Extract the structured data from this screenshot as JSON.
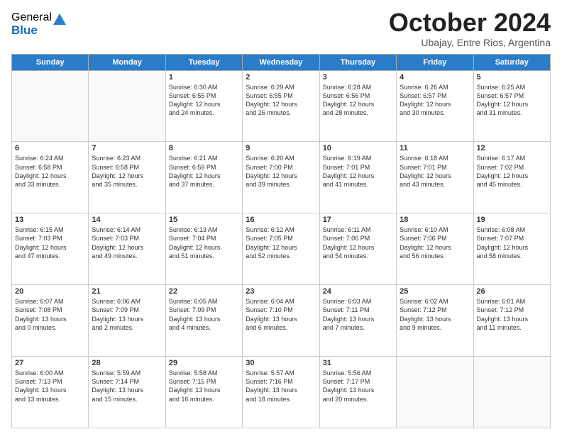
{
  "logo": {
    "general": "General",
    "blue": "Blue"
  },
  "header": {
    "month": "October 2024",
    "location": "Ubajay, Entre Rios, Argentina"
  },
  "days": [
    "Sunday",
    "Monday",
    "Tuesday",
    "Wednesday",
    "Thursday",
    "Friday",
    "Saturday"
  ],
  "weeks": [
    [
      {
        "day": "",
        "content": ""
      },
      {
        "day": "",
        "content": ""
      },
      {
        "day": "1",
        "content": "Sunrise: 6:30 AM\nSunset: 6:55 PM\nDaylight: 12 hours\nand 24 minutes."
      },
      {
        "day": "2",
        "content": "Sunrise: 6:29 AM\nSunset: 6:55 PM\nDaylight: 12 hours\nand 26 minutes."
      },
      {
        "day": "3",
        "content": "Sunrise: 6:28 AM\nSunset: 6:56 PM\nDaylight: 12 hours\nand 28 minutes."
      },
      {
        "day": "4",
        "content": "Sunrise: 6:26 AM\nSunset: 6:57 PM\nDaylight: 12 hours\nand 30 minutes."
      },
      {
        "day": "5",
        "content": "Sunrise: 6:25 AM\nSunset: 6:57 PM\nDaylight: 12 hours\nand 31 minutes."
      }
    ],
    [
      {
        "day": "6",
        "content": "Sunrise: 6:24 AM\nSunset: 6:58 PM\nDaylight: 12 hours\nand 33 minutes."
      },
      {
        "day": "7",
        "content": "Sunrise: 6:23 AM\nSunset: 6:58 PM\nDaylight: 12 hours\nand 35 minutes."
      },
      {
        "day": "8",
        "content": "Sunrise: 6:21 AM\nSunset: 6:59 PM\nDaylight: 12 hours\nand 37 minutes."
      },
      {
        "day": "9",
        "content": "Sunrise: 6:20 AM\nSunset: 7:00 PM\nDaylight: 12 hours\nand 39 minutes."
      },
      {
        "day": "10",
        "content": "Sunrise: 6:19 AM\nSunset: 7:01 PM\nDaylight: 12 hours\nand 41 minutes."
      },
      {
        "day": "11",
        "content": "Sunrise: 6:18 AM\nSunset: 7:01 PM\nDaylight: 12 hours\nand 43 minutes."
      },
      {
        "day": "12",
        "content": "Sunrise: 6:17 AM\nSunset: 7:02 PM\nDaylight: 12 hours\nand 45 minutes."
      }
    ],
    [
      {
        "day": "13",
        "content": "Sunrise: 6:15 AM\nSunset: 7:03 PM\nDaylight: 12 hours\nand 47 minutes."
      },
      {
        "day": "14",
        "content": "Sunrise: 6:14 AM\nSunset: 7:03 PM\nDaylight: 12 hours\nand 49 minutes."
      },
      {
        "day": "15",
        "content": "Sunrise: 6:13 AM\nSunset: 7:04 PM\nDaylight: 12 hours\nand 51 minutes."
      },
      {
        "day": "16",
        "content": "Sunrise: 6:12 AM\nSunset: 7:05 PM\nDaylight: 12 hours\nand 52 minutes."
      },
      {
        "day": "17",
        "content": "Sunrise: 6:11 AM\nSunset: 7:06 PM\nDaylight: 12 hours\nand 54 minutes."
      },
      {
        "day": "18",
        "content": "Sunrise: 6:10 AM\nSunset: 7:06 PM\nDaylight: 12 hours\nand 56 minutes."
      },
      {
        "day": "19",
        "content": "Sunrise: 6:08 AM\nSunset: 7:07 PM\nDaylight: 12 hours\nand 58 minutes."
      }
    ],
    [
      {
        "day": "20",
        "content": "Sunrise: 6:07 AM\nSunset: 7:08 PM\nDaylight: 13 hours\nand 0 minutes."
      },
      {
        "day": "21",
        "content": "Sunrise: 6:06 AM\nSunset: 7:09 PM\nDaylight: 13 hours\nand 2 minutes."
      },
      {
        "day": "22",
        "content": "Sunrise: 6:05 AM\nSunset: 7:09 PM\nDaylight: 13 hours\nand 4 minutes."
      },
      {
        "day": "23",
        "content": "Sunrise: 6:04 AM\nSunset: 7:10 PM\nDaylight: 13 hours\nand 6 minutes."
      },
      {
        "day": "24",
        "content": "Sunrise: 6:03 AM\nSunset: 7:11 PM\nDaylight: 13 hours\nand 7 minutes."
      },
      {
        "day": "25",
        "content": "Sunrise: 6:02 AM\nSunset: 7:12 PM\nDaylight: 13 hours\nand 9 minutes."
      },
      {
        "day": "26",
        "content": "Sunrise: 6:01 AM\nSunset: 7:12 PM\nDaylight: 13 hours\nand 11 minutes."
      }
    ],
    [
      {
        "day": "27",
        "content": "Sunrise: 6:00 AM\nSunset: 7:13 PM\nDaylight: 13 hours\nand 13 minutes."
      },
      {
        "day": "28",
        "content": "Sunrise: 5:59 AM\nSunset: 7:14 PM\nDaylight: 13 hours\nand 15 minutes."
      },
      {
        "day": "29",
        "content": "Sunrise: 5:58 AM\nSunset: 7:15 PM\nDaylight: 13 hours\nand 16 minutes."
      },
      {
        "day": "30",
        "content": "Sunrise: 5:57 AM\nSunset: 7:16 PM\nDaylight: 13 hours\nand 18 minutes."
      },
      {
        "day": "31",
        "content": "Sunrise: 5:56 AM\nSunset: 7:17 PM\nDaylight: 13 hours\nand 20 minutes."
      },
      {
        "day": "",
        "content": ""
      },
      {
        "day": "",
        "content": ""
      }
    ]
  ]
}
